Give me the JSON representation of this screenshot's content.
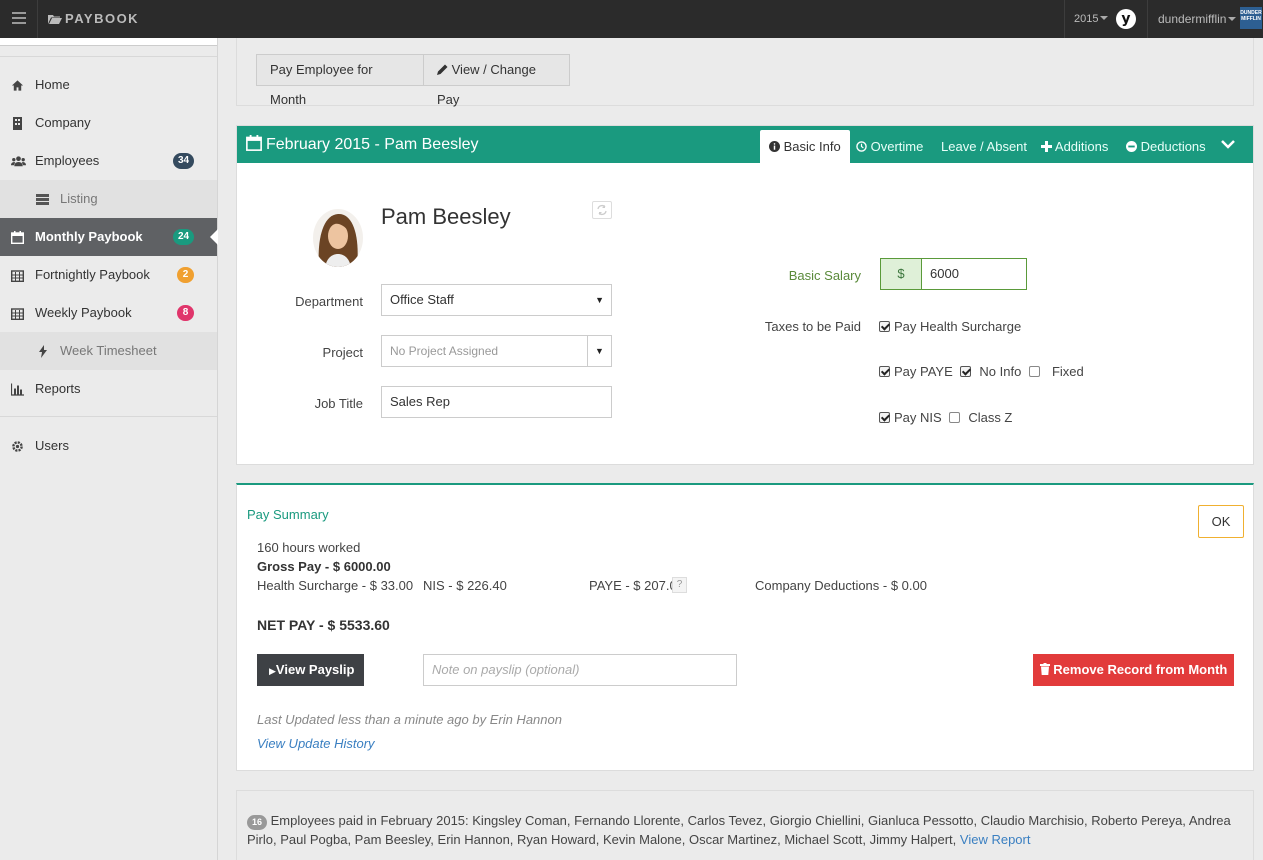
{
  "topbar": {
    "brand": "PAYBOOK",
    "year": "2015",
    "avatar_letter": "y",
    "user": "dundermifflin",
    "company_logo_text": "DUNDER MIFFLIN"
  },
  "sidebar": {
    "items": [
      {
        "label": "Home",
        "icon": "home-icon"
      },
      {
        "label": "Company",
        "icon": "building-icon"
      },
      {
        "label": "Employees",
        "icon": "users-icon",
        "badge": "34",
        "badge_color": "#344a5e"
      },
      {
        "label": "Listing",
        "icon": "list-icon"
      },
      {
        "label": "Monthly Paybook",
        "icon": "calendar-icon",
        "badge": "24",
        "badge_color": "#1a9a7f"
      },
      {
        "label": "Fortnightly Paybook",
        "icon": "calendar-icon",
        "badge": "2",
        "badge_color": "#f0a030"
      },
      {
        "label": "Weekly Paybook",
        "icon": "calendar-icon",
        "badge": "8",
        "badge_color": "#e0356b"
      },
      {
        "label": "Week Timesheet",
        "icon": "bolt-icon"
      },
      {
        "label": "Reports",
        "icon": "bar-chart-icon"
      },
      {
        "label": "Users",
        "icon": "gear-icon"
      }
    ]
  },
  "actions": {
    "pay_employee": "Pay Employee for Month",
    "view_change_pay": "View / Change Pay"
  },
  "employee_card": {
    "title": "February 2015 - Pam Beesley",
    "tabs": [
      "Basic Info",
      "Overtime",
      "Leave / Absent",
      "Additions",
      "Deductions"
    ],
    "name": "Pam Beesley",
    "department_label": "Department",
    "department_value": "Office Staff",
    "project_label": "Project",
    "project_placeholder": "No Project Assigned",
    "job_title_label": "Job Title",
    "job_title_value": "Sales Rep",
    "salary_label": "Basic Salary",
    "currency_symbol": "$",
    "salary_value": "6000",
    "taxes_label": "Taxes to be Paid",
    "taxes": {
      "health_surcharge": "Pay Health Surcharge",
      "paye": "Pay PAYE",
      "no_info": "No Info",
      "fixed": "Fixed",
      "nis": "Pay NIS",
      "class_z": "Class Z"
    }
  },
  "summary": {
    "title": "Pay Summary",
    "ok": "OK",
    "hours": "160 hours worked",
    "gross": "Gross Pay - $ 6000.00",
    "health": "Health Surcharge - $ 33.00",
    "nis": "NIS - $ 226.40",
    "paye": "PAYE - $ 207.00",
    "paye_help": "?",
    "company_deductions": "Company Deductions - $ 0.00",
    "net": "NET PAY - $ 5533.60",
    "view_payslip": "View Payslip",
    "note_placeholder": "Note on payslip (optional)",
    "remove": "Remove Record from Month",
    "last_updated": "Last Updated less than a minute ago by Erin Hannon",
    "history_link": "View Update History"
  },
  "paid_employees": {
    "count": "16",
    "text": "Employees paid in February 2015: Kingsley Coman, Fernando Llorente, Carlos Tevez, Giorgio Chiellini, Gianluca Pessotto, Claudio Marchisio, Roberto Pereya, Andrea Pirlo, Paul Pogba, Pam Beesley, Erin Hannon, Ryan Howard, Kevin Malone, Oscar Martinez, Michael Scott, Jimmy Halpert,",
    "link": "View Report"
  },
  "colors": {
    "brand_green": "#1a9a7f",
    "danger": "#e23b3b",
    "dark_button": "#3e4145",
    "link": "#3a7fc1"
  }
}
